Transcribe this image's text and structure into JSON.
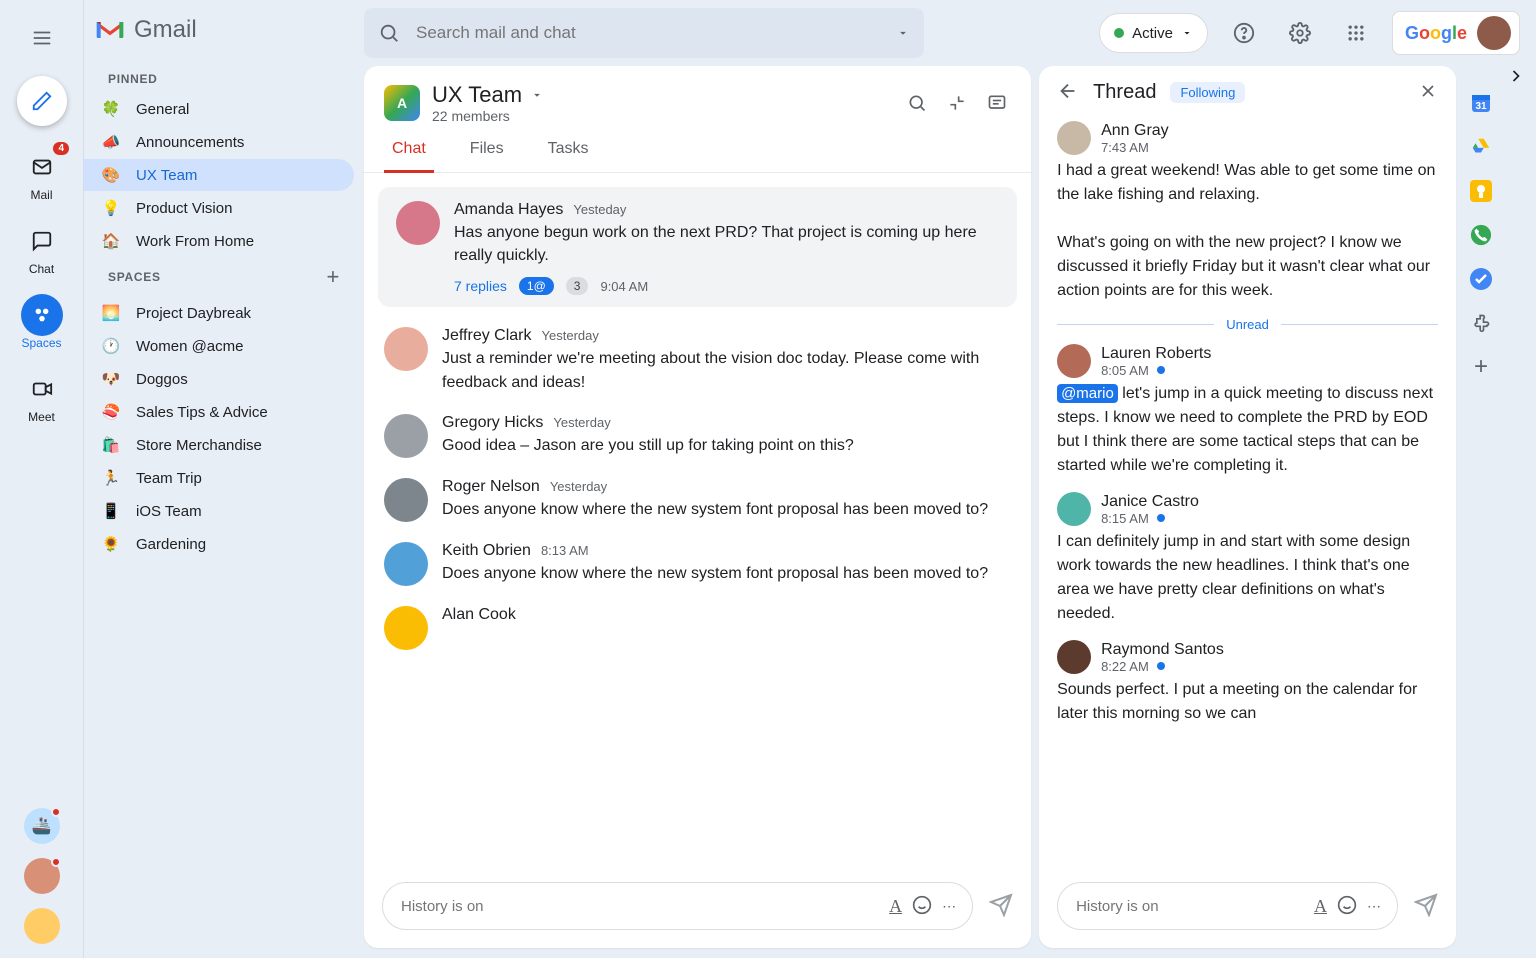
{
  "product": "Gmail",
  "search_placeholder": "Search mail and chat",
  "status_label": "Active",
  "rail": {
    "mail_label": "Mail",
    "mail_badge": "4",
    "chat_label": "Chat",
    "spaces_label": "Spaces",
    "meet_label": "Meet"
  },
  "sections": {
    "pinned_title": "PINNED",
    "spaces_title": "SPACES"
  },
  "pinned": [
    {
      "emoji": "🍀",
      "label": "General"
    },
    {
      "emoji": "📣",
      "label": "Announcements"
    },
    {
      "emoji": "🎨",
      "label": "UX Team",
      "active": true
    },
    {
      "emoji": "💡",
      "label": "Product Vision"
    },
    {
      "emoji": "🏠",
      "label": "Work From Home"
    }
  ],
  "spaces": [
    {
      "emoji": "🌅",
      "label": "Project Daybreak"
    },
    {
      "emoji": "🕐",
      "label": "Women @acme"
    },
    {
      "emoji": "🐶",
      "label": "Doggos"
    },
    {
      "emoji": "🍣",
      "label": "Sales Tips & Advice"
    },
    {
      "emoji": "🛍️",
      "label": "Store Merchandise"
    },
    {
      "emoji": "🏃",
      "label": "Team Trip"
    },
    {
      "emoji": "📱",
      "label": "iOS Team"
    },
    {
      "emoji": "🌻",
      "label": "Gardening"
    }
  ],
  "space": {
    "name": "UX Team",
    "members": "22 members",
    "tabs": {
      "chat": "Chat",
      "files": "Files",
      "tasks": "Tasks"
    }
  },
  "messages": [
    {
      "pinned": true,
      "name": "Amanda Hayes",
      "time": "Yesteday",
      "text": "Has anyone begun work on the next PRD? That project is coming up here really quickly.",
      "replies": {
        "count_label": "7 replies",
        "mention_pill": "1@",
        "num_pill": "3",
        "reply_time": "9:04 AM"
      },
      "av": "#d6788a"
    },
    {
      "name": "Jeffrey Clark",
      "time": "Yesterday",
      "text": "Just a reminder we're meeting about the vision doc today. Please come with feedback and ideas!",
      "av": "#e9ad9d"
    },
    {
      "name": "Gregory Hicks",
      "time": "Yesterday",
      "text": "Good idea – Jason are you still up for taking point on this?",
      "av": "#9aa0a6"
    },
    {
      "name": "Roger Nelson",
      "time": "Yesterday",
      "text": "Does anyone know where the new system font proposal has been moved to?",
      "av": "#7d868c"
    },
    {
      "name": "Keith Obrien",
      "time": "8:13 AM",
      "text": "Does anyone know where the new system font proposal has been moved to?",
      "av": "#52a0d8"
    },
    {
      "name": "Alan Cook",
      "time": "",
      "text": "",
      "av": "#fbbc04"
    }
  ],
  "thread": {
    "title": "Thread",
    "following": "Following",
    "unread_label": "Unread",
    "items": [
      {
        "name": "Ann Gray",
        "time": "7:43 AM",
        "av": "#c7b9a6",
        "dot": false,
        "text": "I had a great weekend! Was able to get some time on the lake fishing and relaxing.",
        "text2": "What's going on with the new project? I know we discussed it briefly Friday but it wasn't clear what our action points are for this week."
      },
      {
        "name": "Lauren Roberts",
        "time": "8:05 AM",
        "av": "#b36b57",
        "dot": true,
        "mention": "@mario",
        "text": " let's jump in a quick meeting to discuss next steps. I know we need to complete the PRD by EOD but I think there are some tactical steps that can be started while we're completing it."
      },
      {
        "name": "Janice Castro",
        "time": "8:15 AM",
        "av": "#4fb5a9",
        "dot": true,
        "text": "I can definitely jump in and start with some design work towards the new headlines. I think that's one area we have pretty clear definitions on what's needed."
      },
      {
        "name": "Raymond Santos",
        "time": "8:22 AM",
        "av": "#5c3a2e",
        "dot": true,
        "text": "Sounds perfect. I put a meeting on the calendar for later this morning so we can"
      }
    ]
  },
  "composer_placeholder": "History is on"
}
